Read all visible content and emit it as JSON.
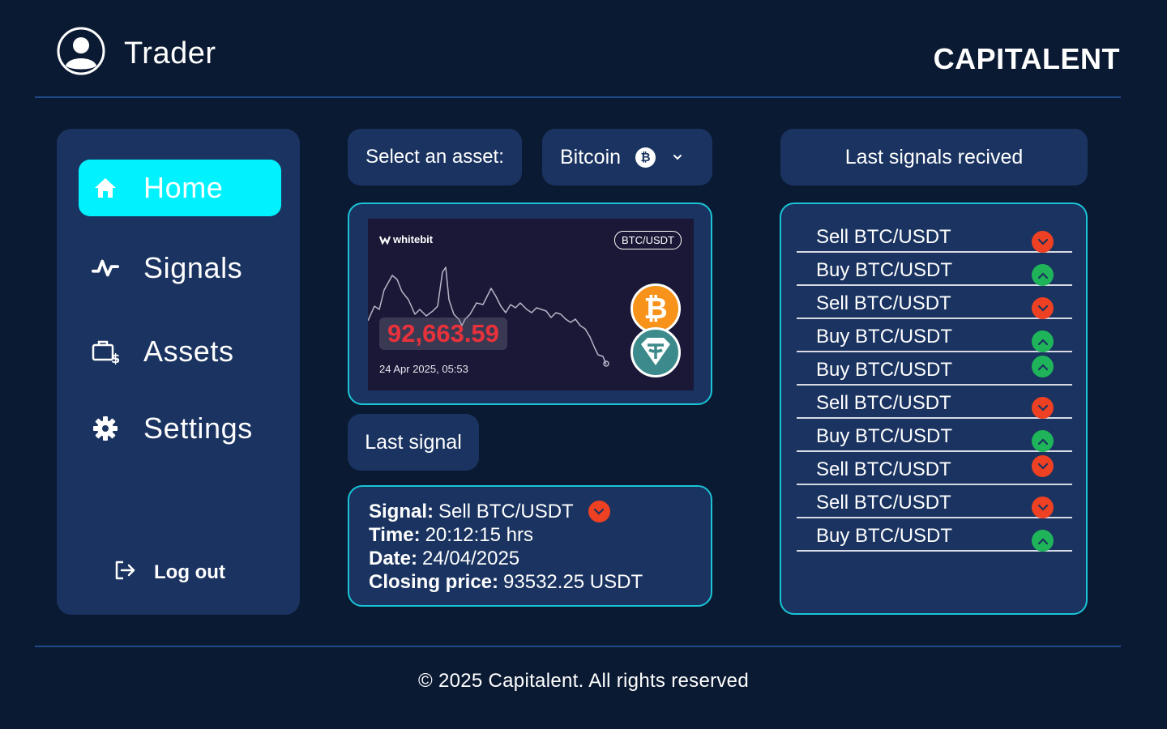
{
  "header": {
    "title": "Trader",
    "brand": "CAPITALENT",
    "user_icon": "user-circle-icon"
  },
  "sidebar": {
    "items": [
      {
        "label": "Home",
        "icon": "home-icon",
        "active": true
      },
      {
        "label": "Signals",
        "icon": "activity-icon",
        "active": false
      },
      {
        "label": "Assets",
        "icon": "briefcase-dollar-icon",
        "active": false
      },
      {
        "label": "Settings",
        "icon": "gear-icon",
        "active": false
      }
    ],
    "logout_label": "Log out"
  },
  "asset": {
    "label": "Select an asset:",
    "selected": "Bitcoin",
    "coin_symbol": "₿"
  },
  "chart": {
    "brand": "whitebit",
    "pair": "BTC/USDT",
    "price": "92,663.59",
    "date": "24 Apr 2025, 05:53"
  },
  "last_signal": {
    "label": "Last signal",
    "signal_label": "Signal:",
    "signal_value": "Sell BTC/USDT",
    "signal_type": "sell",
    "time_label": "Time:",
    "time_value": "20:12:15 hrs",
    "date_label": "Date:",
    "date_value": "24/04/2025",
    "price_label": "Closing price:",
    "price_value": "93532.25 USDT"
  },
  "signals_panel": {
    "title": "Last signals recived",
    "rows": [
      {
        "label": "Sell BTC/USDT",
        "type": "sell"
      },
      {
        "label": "Buy BTC/USDT",
        "type": "buy"
      },
      {
        "label": "Sell BTC/USDT",
        "type": "sell"
      },
      {
        "label": "Buy BTC/USDT",
        "type": "buy"
      },
      {
        "label": "Buy BTC/USDT",
        "type": "buy"
      },
      {
        "label": "Sell BTC/USDT",
        "type": "sell"
      },
      {
        "label": "Buy BTC/USDT",
        "type": "buy"
      },
      {
        "label": "Sell BTC/USDT",
        "type": "sell"
      },
      {
        "label": "Sell BTC/USDT",
        "type": "sell"
      },
      {
        "label": "Buy BTC/USDT",
        "type": "buy"
      }
    ]
  },
  "footer": {
    "text": "© 2025 Capitalent. All rights reserved"
  },
  "colors": {
    "background": "#0b1a33",
    "panel": "#1a3360",
    "accent": "#00f2ff",
    "border": "#19c4d6",
    "sell": "#ee4022",
    "buy": "#1fb45a",
    "price": "#e8323b"
  }
}
